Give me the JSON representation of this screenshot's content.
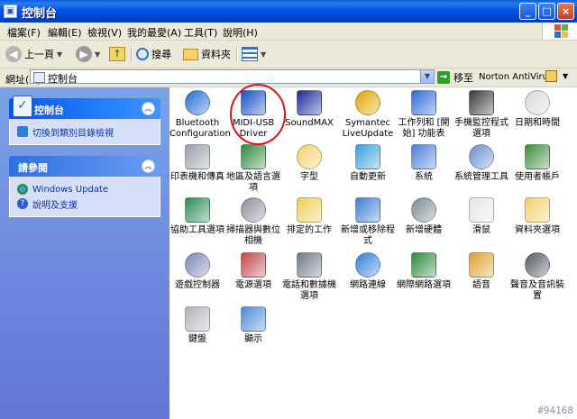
{
  "window": {
    "title": "控制台",
    "buttons": {
      "minimize": "_",
      "maximize": "□",
      "close": "×"
    }
  },
  "menubar": {
    "items": [
      "檔案(F)",
      "編輯(E)",
      "檢視(V)",
      "我的最愛(A)",
      "工具(T)",
      "說明(H)"
    ]
  },
  "toolbar": {
    "back": "上一頁",
    "search": "搜尋",
    "folders": "資料夾"
  },
  "address": {
    "label": "網址(D)",
    "value": "控制台",
    "go": "移至",
    "norton": "Norton AntiVirus"
  },
  "sidebar": {
    "panel1": {
      "title": "控制台",
      "link": "切換到類別目錄檢視"
    },
    "panel2": {
      "title": "請參閱",
      "links": [
        "Windows Update",
        "說明及支援"
      ]
    }
  },
  "icons": [
    {
      "label": "Bluetooth Configuration",
      "glyph": "bluetooth-icon",
      "color": "#1f6fd1"
    },
    {
      "label": "MIDI-USB Driver",
      "glyph": "midi-usb-icon",
      "color": "#1a4fc4"
    },
    {
      "label": "SoundMAX",
      "glyph": "soundmax-icon",
      "color": "#1b2a9a"
    },
    {
      "label": "Symantec LiveUpdate",
      "glyph": "liveupdate-icon",
      "color": "#e0a600"
    },
    {
      "label": "工作列和 [開始] 功能表",
      "glyph": "taskbar-icon",
      "color": "#2a6bd6"
    },
    {
      "label": "手機監控程式選項",
      "glyph": "phone-icon",
      "color": "#3a3a3a"
    },
    {
      "label": "日期和時間",
      "glyph": "clock-icon",
      "color": "#d9d9d9"
    },
    {
      "label": "印表機和傳真",
      "glyph": "printer-icon",
      "color": "#9aa0a8"
    },
    {
      "label": "地區及語言選項",
      "glyph": "globe-icon",
      "color": "#2d8a3e"
    },
    {
      "label": "字型",
      "glyph": "font-folder-icon",
      "color": "#f3d16b"
    },
    {
      "label": "自動更新",
      "glyph": "update-icon",
      "color": "#3aa0e0"
    },
    {
      "label": "系統",
      "glyph": "system-icon",
      "color": "#4a7fd8"
    },
    {
      "label": "系統管理工具",
      "glyph": "admin-tools-icon",
      "color": "#6b8fd3"
    },
    {
      "label": "使用者帳戶",
      "glyph": "users-icon",
      "color": "#3c8f3c"
    },
    {
      "label": "協助工具選項",
      "glyph": "accessibility-icon",
      "color": "#2e8b57"
    },
    {
      "label": "掃描器與數位相機",
      "glyph": "scanner-icon",
      "color": "#8a8f98"
    },
    {
      "label": "排定的工作",
      "glyph": "scheduled-tasks-icon",
      "color": "#f0cf5a"
    },
    {
      "label": "新增或移除程式",
      "glyph": "add-remove-icon",
      "color": "#3f7fd6"
    },
    {
      "label": "新增硬體",
      "glyph": "hardware-icon",
      "color": "#7a8a96"
    },
    {
      "label": "滑鼠",
      "glyph": "mouse-icon",
      "color": "#e6e6e6"
    },
    {
      "label": "資料夾選項",
      "glyph": "folder-options-icon",
      "color": "#f3d16b"
    },
    {
      "label": "遊戲控制器",
      "glyph": "gamepad-icon",
      "color": "#7a86b8"
    },
    {
      "label": "電源選項",
      "glyph": "power-icon",
      "color": "#c04848"
    },
    {
      "label": "電話和數據機選項",
      "glyph": "modem-icon",
      "color": "#6b7b8a"
    },
    {
      "label": "網路連線",
      "glyph": "network-icon",
      "color": "#2f7fd6"
    },
    {
      "label": "網際網路選項",
      "glyph": "internet-icon",
      "color": "#2d8a3e"
    },
    {
      "label": "語音",
      "glyph": "speech-icon",
      "color": "#e0a030"
    },
    {
      "label": "聲音及音訊裝置",
      "glyph": "speaker-icon",
      "color": "#555a66"
    },
    {
      "label": "鍵盤",
      "glyph": "keyboard-icon",
      "color": "#b0b4bc"
    },
    {
      "label": "顯示",
      "glyph": "display-icon",
      "color": "#4a8ad8"
    }
  ],
  "watermark": "#94168",
  "colors": {
    "highlight": "#d8141b",
    "titlebar": "#0054e3"
  }
}
